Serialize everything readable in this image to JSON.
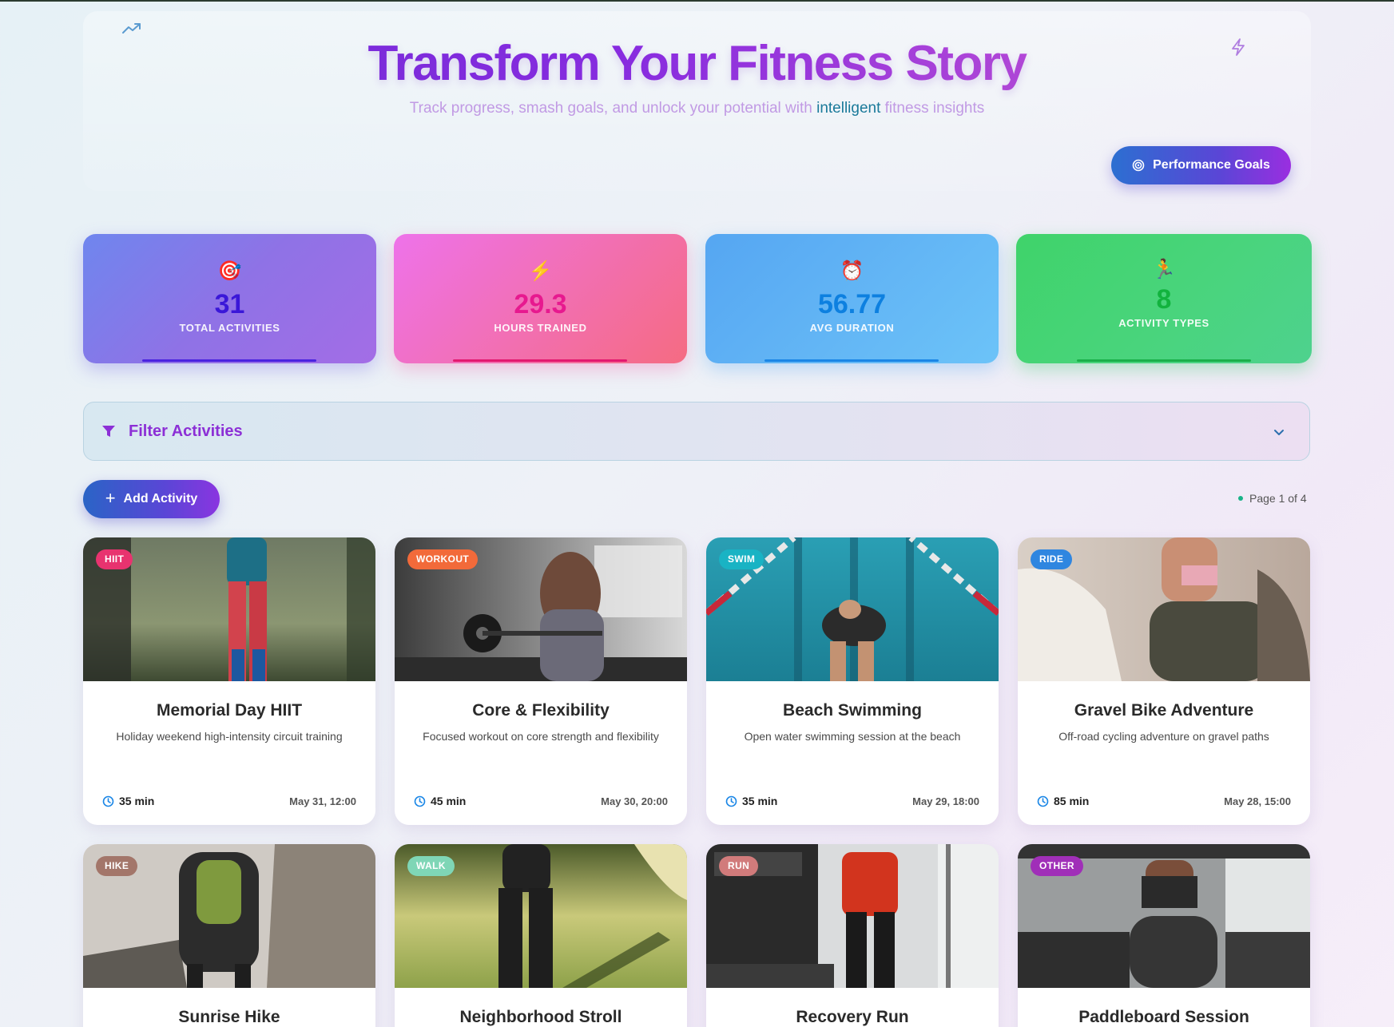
{
  "hero": {
    "title": "Transform Your Fitness Story",
    "subtitle_before": "Track progress, smash goals, and unlock your potential with ",
    "subtitle_highlight": "intelligent",
    "subtitle_after": " fitness insights",
    "goals_button": "Performance Goals"
  },
  "stats": [
    {
      "icon": "🎯",
      "value": "31",
      "label": "TOTAL ACTIVITIES"
    },
    {
      "icon": "⚡",
      "value": "29.3",
      "label": "HOURS TRAINED"
    },
    {
      "icon": "⏰",
      "value": "56.77",
      "label": "AVG DURATION"
    },
    {
      "icon": "🏃",
      "value": "8",
      "label": "ACTIVITY TYPES"
    }
  ],
  "filter": {
    "label": "Filter Activities"
  },
  "actions": {
    "add_label": "Add Activity",
    "page_indicator": "Page 1 of 4"
  },
  "cards": [
    {
      "badge": "HIIT",
      "badge_color": "#e8336f",
      "title": "Memorial Day HIIT",
      "desc": "Holiday weekend high-intensity circuit training",
      "duration": "35 min",
      "date": "May 31, 12:00"
    },
    {
      "badge": "WORKOUT",
      "badge_color": "#f26a3a",
      "title": "Core & Flexibility",
      "desc": "Focused workout on core strength and flexibility",
      "duration": "45 min",
      "date": "May 30, 20:00"
    },
    {
      "badge": "SWIM",
      "badge_color": "#19b3c4",
      "title": "Beach Swimming",
      "desc": "Open water swimming session at the beach",
      "duration": "35 min",
      "date": "May 29, 18:00"
    },
    {
      "badge": "RIDE",
      "badge_color": "#2f86e0",
      "title": "Gravel Bike Adventure",
      "desc": "Off-road cycling adventure on gravel paths",
      "duration": "85 min",
      "date": "May 28, 15:00"
    },
    {
      "badge": "HIKE",
      "badge_color": "#a3766a",
      "title": "Sunrise Hike"
    },
    {
      "badge": "WALK",
      "badge_color": "#7fd6b6",
      "title": "Neighborhood Stroll"
    },
    {
      "badge": "RUN",
      "badge_color": "#d17b7b",
      "title": "Recovery Run"
    },
    {
      "badge": "OTHER",
      "badge_color": "#a02fb8",
      "title": "Paddleboard Session"
    }
  ]
}
